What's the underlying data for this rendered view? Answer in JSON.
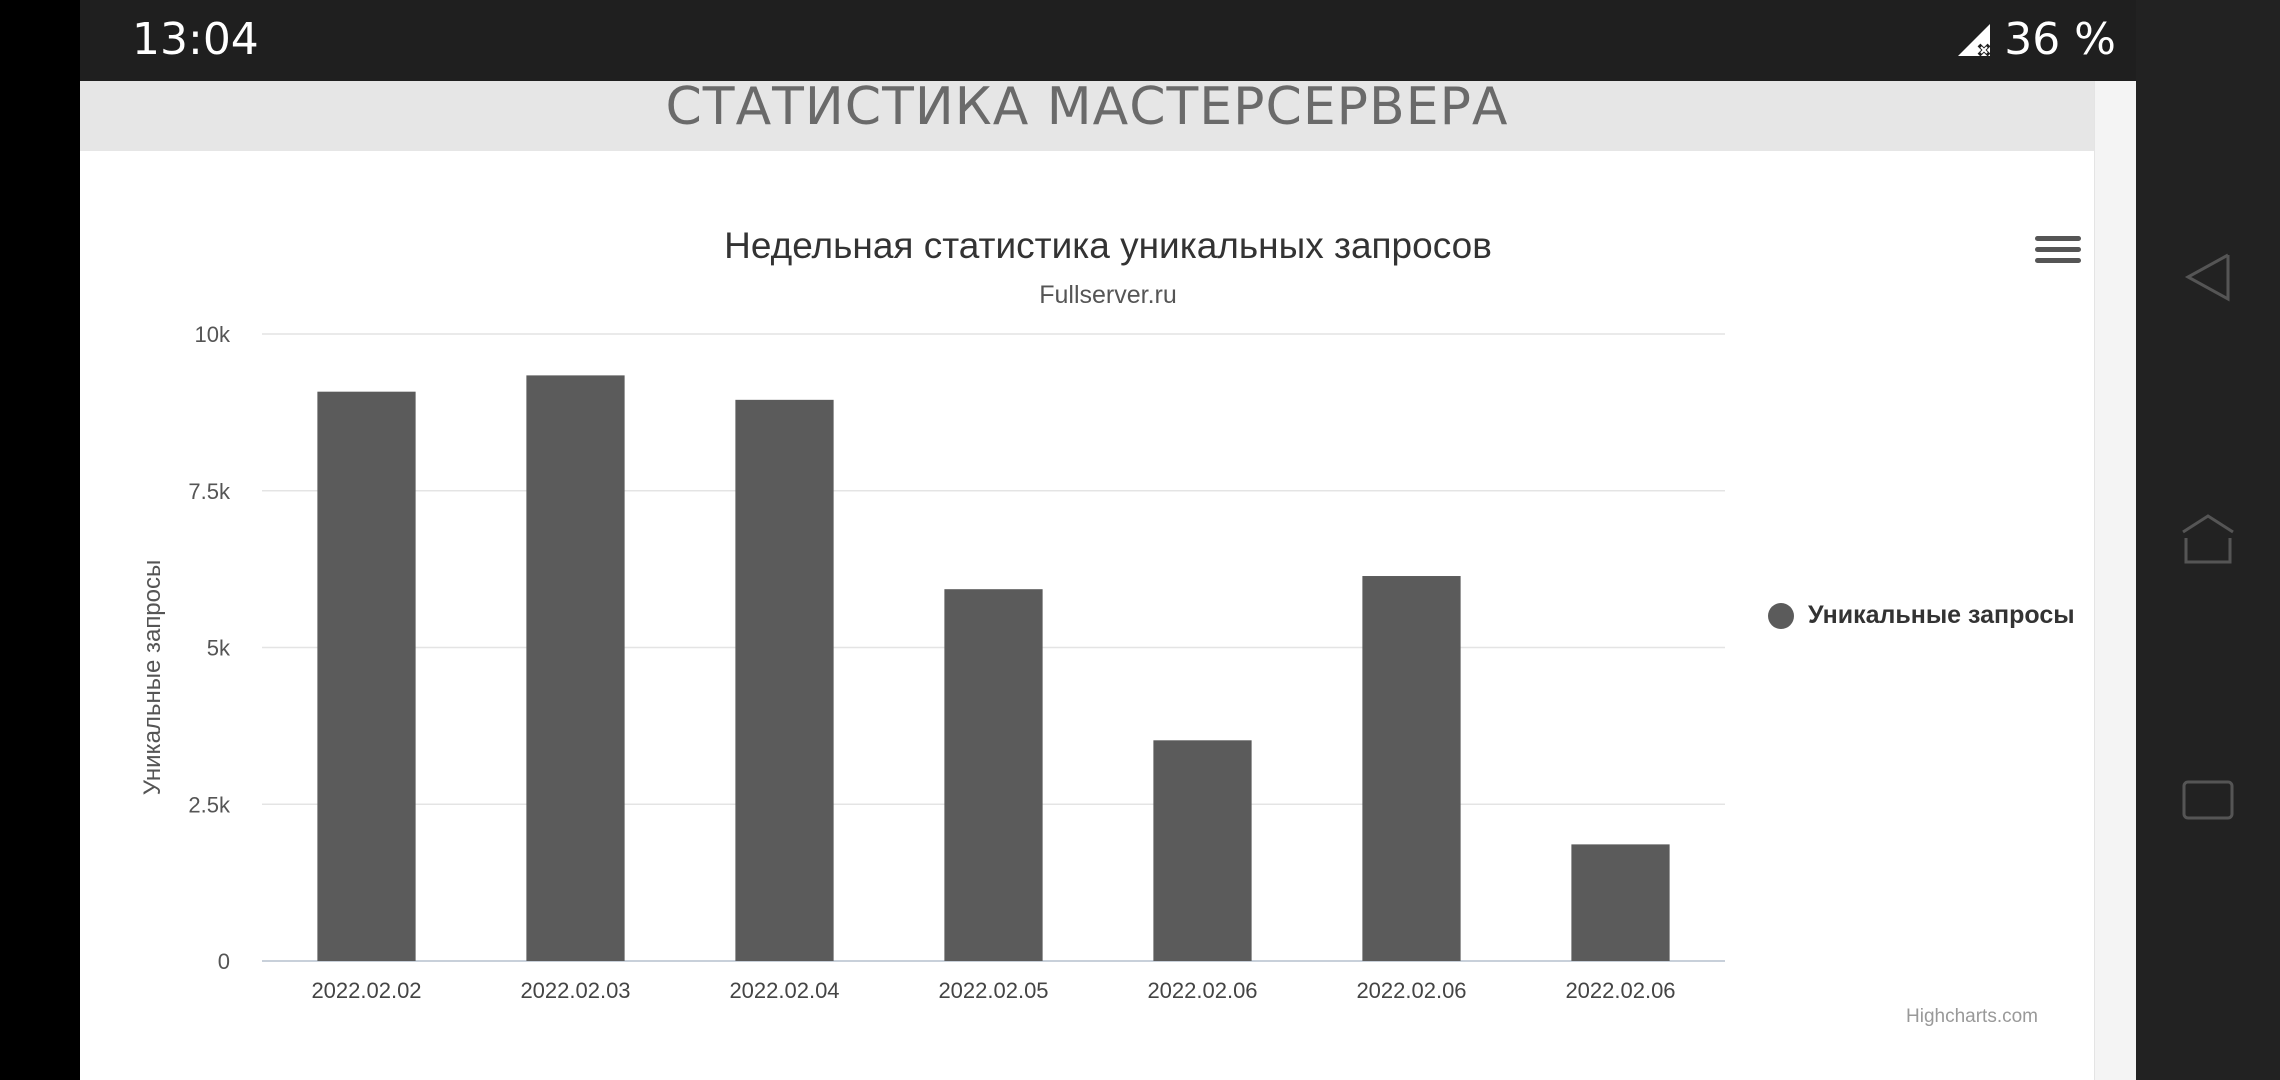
{
  "status_bar": {
    "time": "13:04",
    "battery": "36 %",
    "icons": [
      "signal-no-data-icon"
    ]
  },
  "page": {
    "header_title": "СТАТИСТИКА МАСТЕРСЕРВЕРА"
  },
  "chart_data": {
    "type": "bar",
    "title": "Недельная статистика уникальных запросов",
    "subtitle": "Fullserver.ru",
    "ylabel": "Уникальные запросы",
    "xlabel": "",
    "ylim": [
      0,
      10000
    ],
    "y_ticks": [
      "0",
      "2.5k",
      "5k",
      "7.5k",
      "10k"
    ],
    "categories": [
      "2022.02.02",
      "2022.02.03",
      "2022.02.04",
      "2022.02.05",
      "2022.02.06",
      "2022.02.06",
      "2022.02.06"
    ],
    "series": [
      {
        "name": "Уникальные запросы",
        "color": "#5b5b5b",
        "values": [
          9080,
          9340,
          8950,
          5930,
          3520,
          6140,
          1860
        ]
      }
    ],
    "legend_position": "right",
    "grid": true,
    "credits": "Highcharts.com"
  },
  "nav_bar": {
    "icons": [
      "back-icon",
      "home-icon",
      "recents-icon"
    ]
  }
}
